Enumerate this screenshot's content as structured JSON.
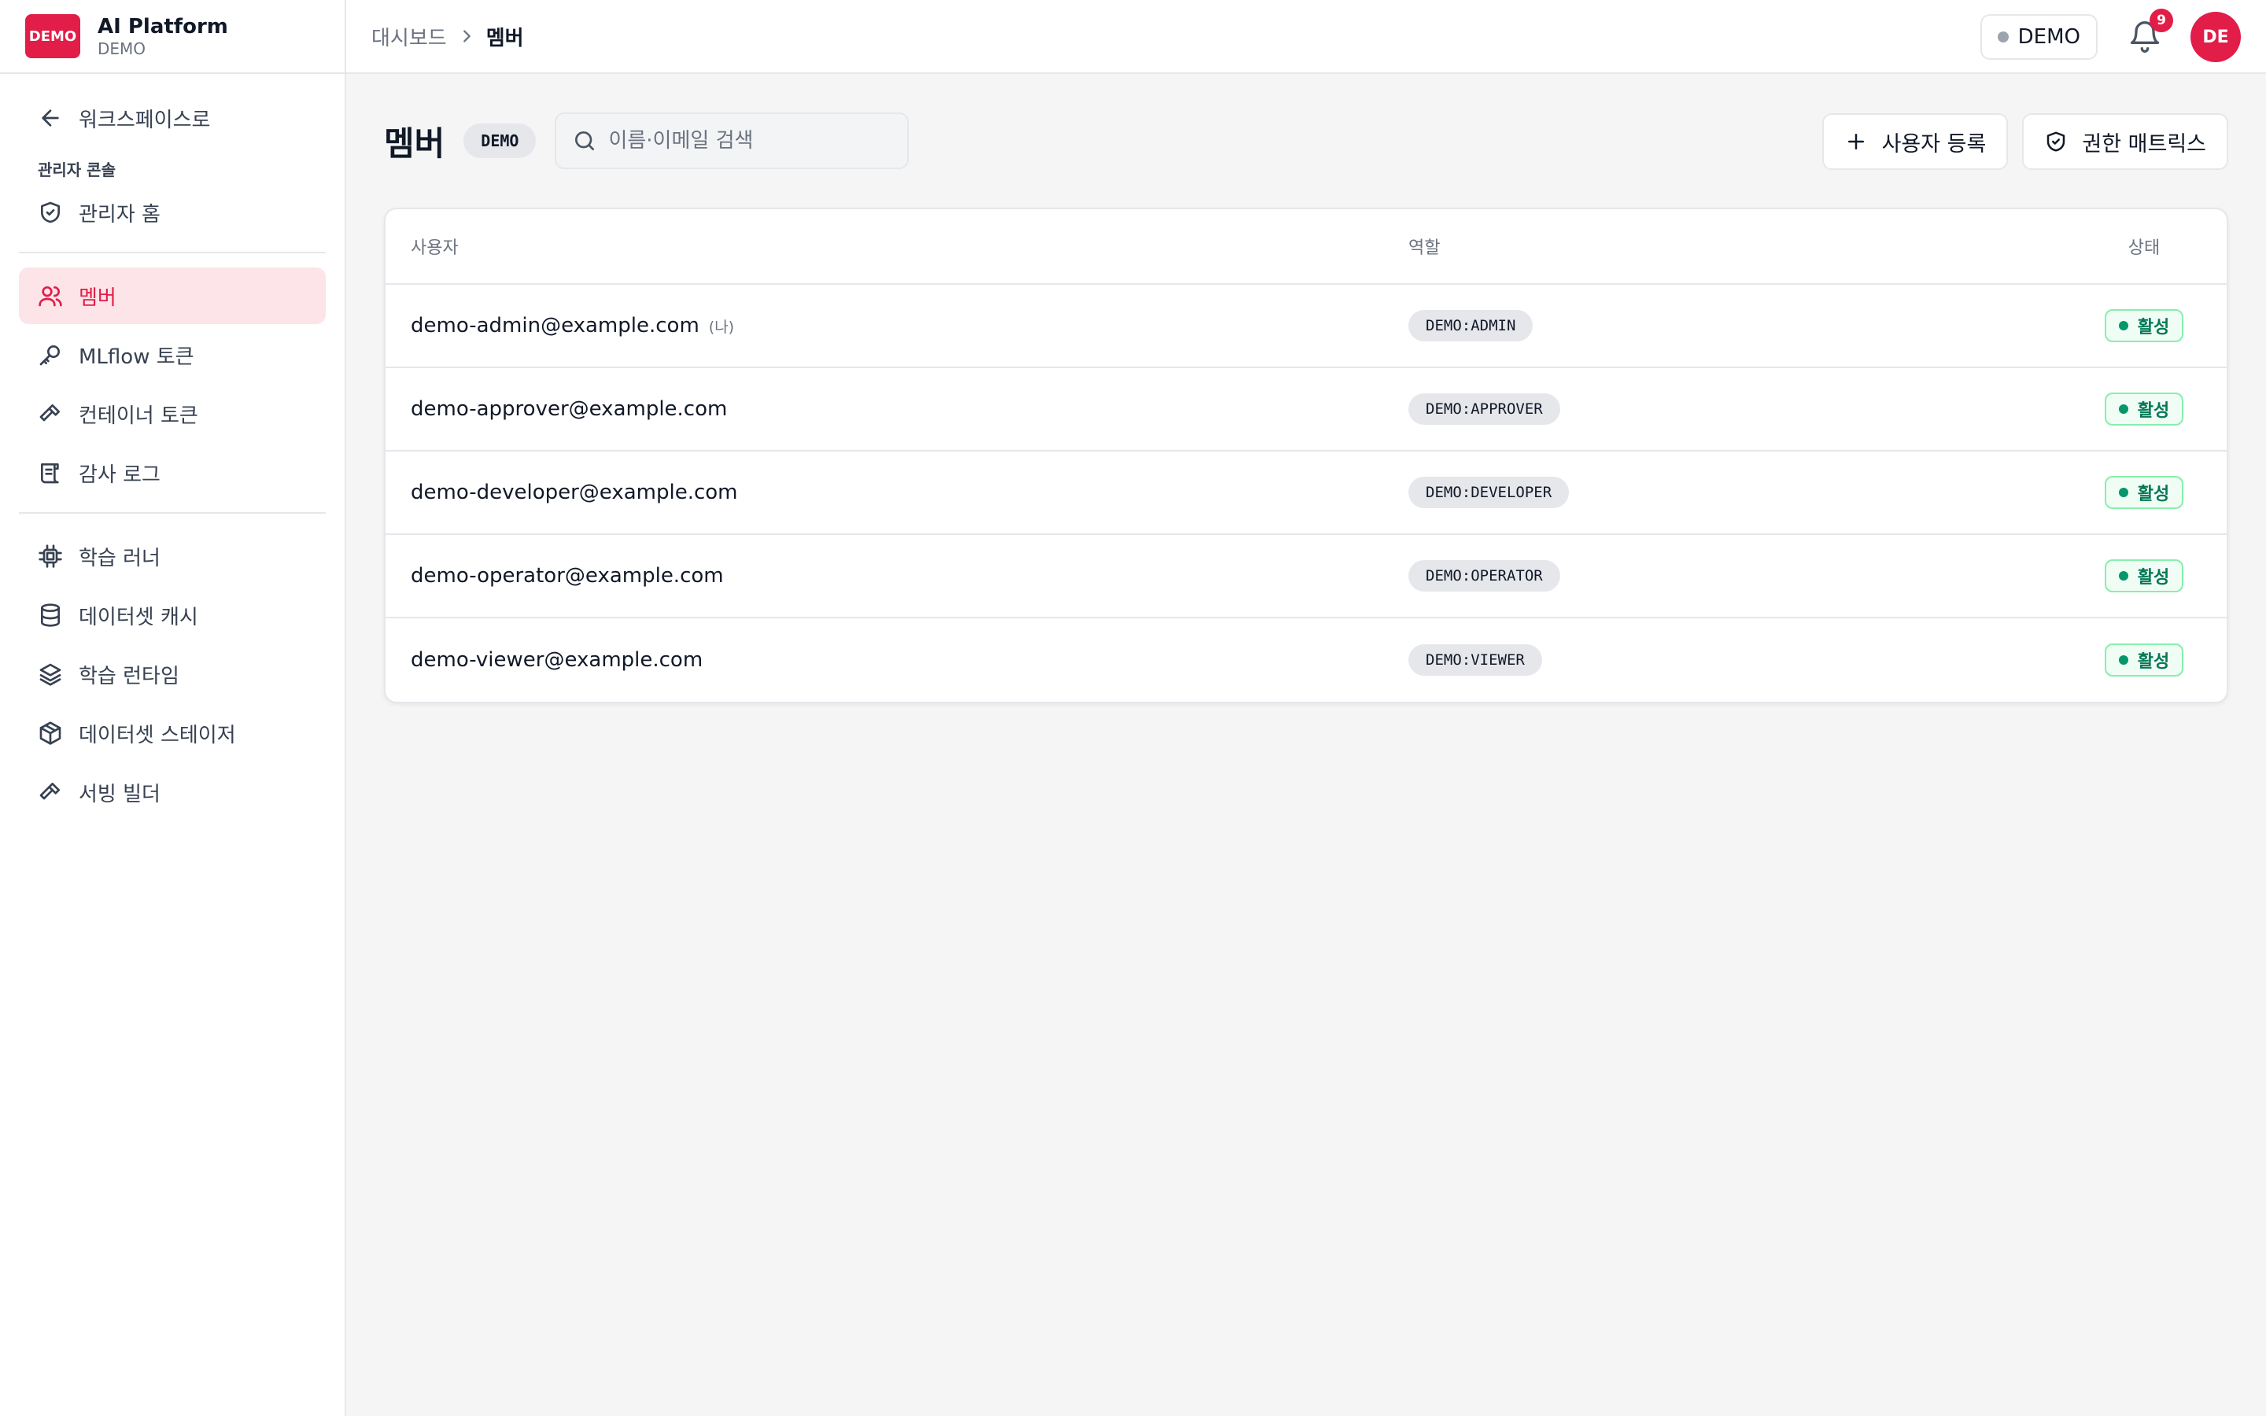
{
  "brand": {
    "logo_text": "DEMO",
    "name": "AI Platform",
    "workspace": "DEMO"
  },
  "sidebar": {
    "back_label": "워크스페이스로",
    "section_label": "관리자 콘솔",
    "admin_items": [
      {
        "label": "관리자 홈",
        "icon": "shield-check-icon"
      },
      {
        "label": "멤버",
        "icon": "users-icon",
        "active": true
      },
      {
        "label": "MLflow 토큰",
        "icon": "key-icon"
      },
      {
        "label": "컨테이너 토큰",
        "icon": "hammer-icon"
      },
      {
        "label": "감사 로그",
        "icon": "scroll-icon"
      }
    ],
    "tool_items": [
      {
        "label": "학습 러너",
        "icon": "cpu-icon"
      },
      {
        "label": "데이터셋 캐시",
        "icon": "database-icon"
      },
      {
        "label": "학습 런타임",
        "icon": "layers-icon"
      },
      {
        "label": "데이터셋 스테이저",
        "icon": "package-icon"
      },
      {
        "label": "서빙 빌더",
        "icon": "hammer-icon"
      }
    ]
  },
  "header": {
    "breadcrumb_parent": "대시보드",
    "breadcrumb_current": "멤버",
    "workspace_label": "DEMO",
    "notification_count": "9",
    "avatar_initials": "DE"
  },
  "page": {
    "title": "멤버",
    "workspace_badge": "DEMO",
    "search_placeholder": "이름·이메일 검색",
    "add_user_label": "사용자 등록",
    "permission_matrix_label": "권한 매트릭스"
  },
  "table": {
    "columns": {
      "user": "사용자",
      "role": "역할",
      "status": "상태"
    },
    "rows": [
      {
        "email": "demo-admin@example.com",
        "me": "(나)",
        "role": "DEMO:ADMIN",
        "status": "활성"
      },
      {
        "email": "demo-approver@example.com",
        "me": "",
        "role": "DEMO:APPROVER",
        "status": "활성"
      },
      {
        "email": "demo-developer@example.com",
        "me": "",
        "role": "DEMO:DEVELOPER",
        "status": "활성"
      },
      {
        "email": "demo-operator@example.com",
        "me": "",
        "role": "DEMO:OPERATOR",
        "status": "활성"
      },
      {
        "email": "demo-viewer@example.com",
        "me": "",
        "role": "DEMO:VIEWER",
        "status": "활성"
      }
    ]
  },
  "colors": {
    "accent": "#e11d48",
    "active_bg": "#fde4e8",
    "status_green": "#047857"
  }
}
